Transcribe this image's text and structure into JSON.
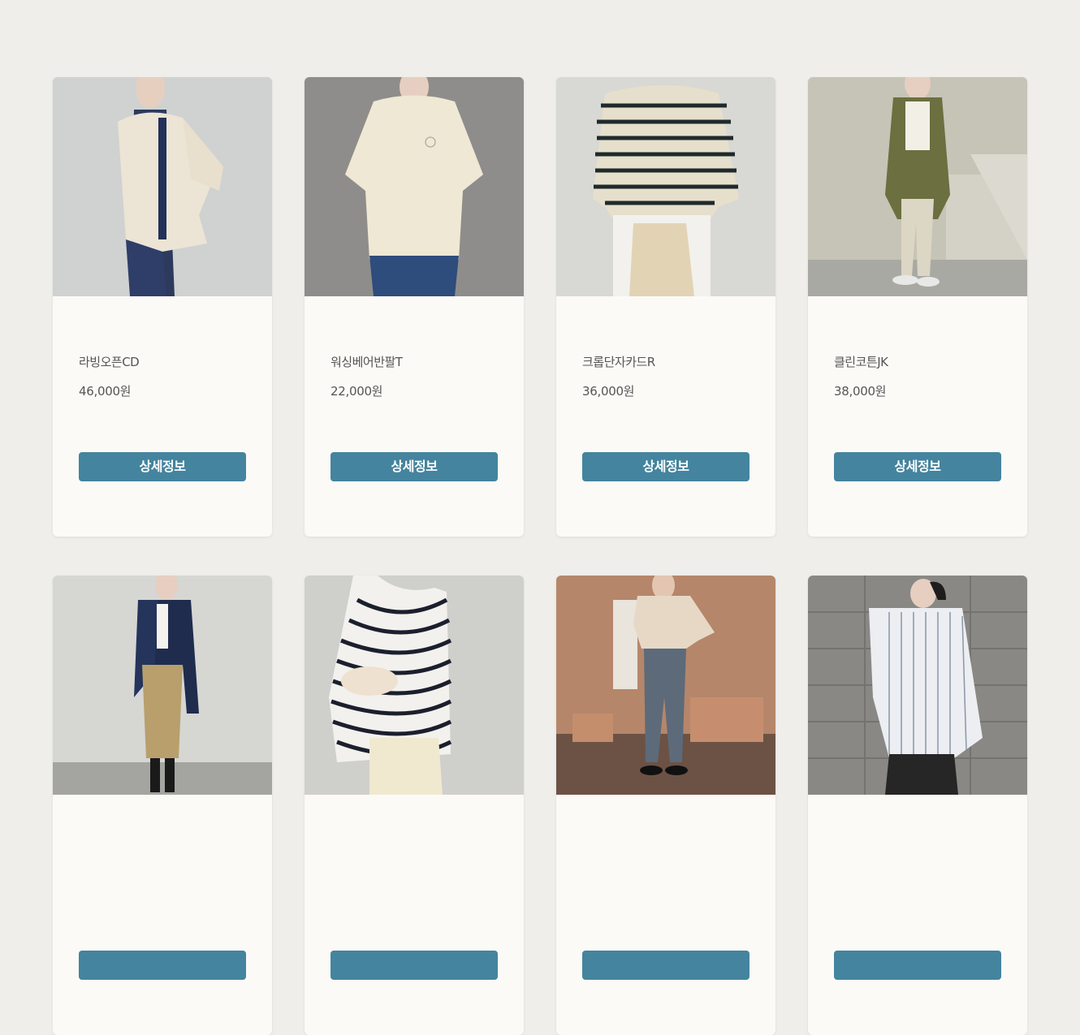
{
  "products": [
    {
      "name": "라빙오픈CD",
      "price": "46,000원",
      "button": "상세정보",
      "photo": "cream-cardigan-photo"
    },
    {
      "name": "워싱베어반팔T",
      "price": "22,000원",
      "button": "상세정보",
      "photo": "ivory-tshirt-photo"
    },
    {
      "name": "크롭단자카드R",
      "price": "36,000원",
      "button": "상세정보",
      "photo": "striped-knit-photo"
    },
    {
      "name": "클린코튼JK",
      "price": "38,000원",
      "button": "상세정보",
      "photo": "khaki-jacket-photo"
    },
    {
      "name": "",
      "price": "",
      "button": "",
      "photo": "navy-shirt-photo"
    },
    {
      "name": "",
      "price": "",
      "button": "",
      "photo": "striped-tee-photo"
    },
    {
      "name": "",
      "price": "",
      "button": "",
      "photo": "beige-sweater-photo"
    },
    {
      "name": "",
      "price": "",
      "button": "",
      "photo": "striped-shirt-photo"
    }
  ],
  "colors": {
    "background": "#efeeeb",
    "card": "#fbfaf7",
    "button": "#44849e",
    "text": "#555555"
  }
}
